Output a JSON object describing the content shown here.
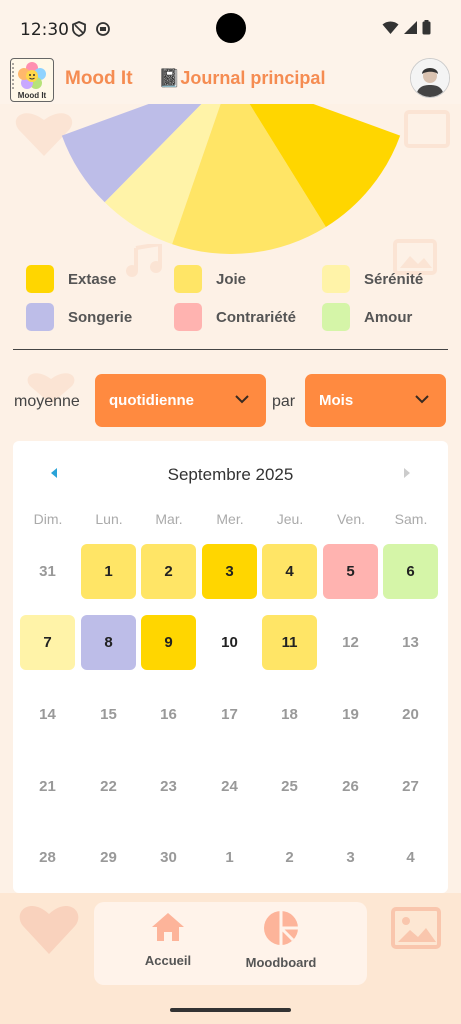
{
  "status_bar": {
    "time": "12:30"
  },
  "app": {
    "logo_text": "Mood It",
    "title": "Mood It",
    "journal_label": "📓Journal principal"
  },
  "colors": {
    "extase": "#ffd600",
    "joie": "#ffe566",
    "serenite": "#fff3a8",
    "songerie": "#bdbde8",
    "contrariete": "#ffb3b0",
    "amour": "#d5f5a8",
    "accent": "#ff8a40",
    "title": "#f58c52"
  },
  "chart_data": {
    "type": "pie",
    "categories": [
      "Songerie",
      "Sérénité",
      "Joie",
      "Extase"
    ],
    "values": [
      18,
      18,
      36,
      27
    ],
    "colors": [
      "#bdbde8",
      "#fff3a8",
      "#ffe566",
      "#ffd600"
    ]
  },
  "legend": [
    {
      "label": "Extase",
      "color": "#ffd600"
    },
    {
      "label": "Joie",
      "color": "#ffe566"
    },
    {
      "label": "Sérénité",
      "color": "#fff3a8"
    },
    {
      "label": "Songerie",
      "color": "#bdbde8"
    },
    {
      "label": "Contrariété",
      "color": "#ffb3b0"
    },
    {
      "label": "Amour",
      "color": "#d5f5a8"
    }
  ],
  "filters": {
    "moyenne_label": "moyenne",
    "frequency_value": "quotidienne",
    "par_label": "par",
    "period_value": "Mois"
  },
  "calendar": {
    "title": "Septembre 2025",
    "weekdays": [
      "Dim.",
      "Lun.",
      "Mar.",
      "Mer.",
      "Jeu.",
      "Ven.",
      "Sam."
    ],
    "weeks": [
      [
        {
          "d": "31"
        },
        {
          "d": "1",
          "mood": "joie"
        },
        {
          "d": "2",
          "mood": "joie"
        },
        {
          "d": "3",
          "mood": "extase"
        },
        {
          "d": "4",
          "mood": "joie"
        },
        {
          "d": "5",
          "mood": "contrariete"
        },
        {
          "d": "6",
          "mood": "amour"
        }
      ],
      [
        {
          "d": "7",
          "mood": "serenite"
        },
        {
          "d": "8",
          "mood": "songerie"
        },
        {
          "d": "9",
          "mood": "extase"
        },
        {
          "d": "10",
          "current": true
        },
        {
          "d": "11",
          "mood": "joie"
        },
        {
          "d": "12"
        },
        {
          "d": "13"
        }
      ],
      [
        {
          "d": "14"
        },
        {
          "d": "15"
        },
        {
          "d": "16"
        },
        {
          "d": "17"
        },
        {
          "d": "18"
        },
        {
          "d": "19"
        },
        {
          "d": "20"
        }
      ],
      [
        {
          "d": "21"
        },
        {
          "d": "22"
        },
        {
          "d": "23"
        },
        {
          "d": "24"
        },
        {
          "d": "25"
        },
        {
          "d": "26"
        },
        {
          "d": "27"
        }
      ],
      [
        {
          "d": "28"
        },
        {
          "d": "29"
        },
        {
          "d": "30"
        },
        {
          "d": "1"
        },
        {
          "d": "2"
        },
        {
          "d": "3"
        },
        {
          "d": "4"
        }
      ]
    ]
  },
  "bottom_nav": {
    "home_label": "Accueil",
    "moodboard_label": "Moodboard"
  }
}
